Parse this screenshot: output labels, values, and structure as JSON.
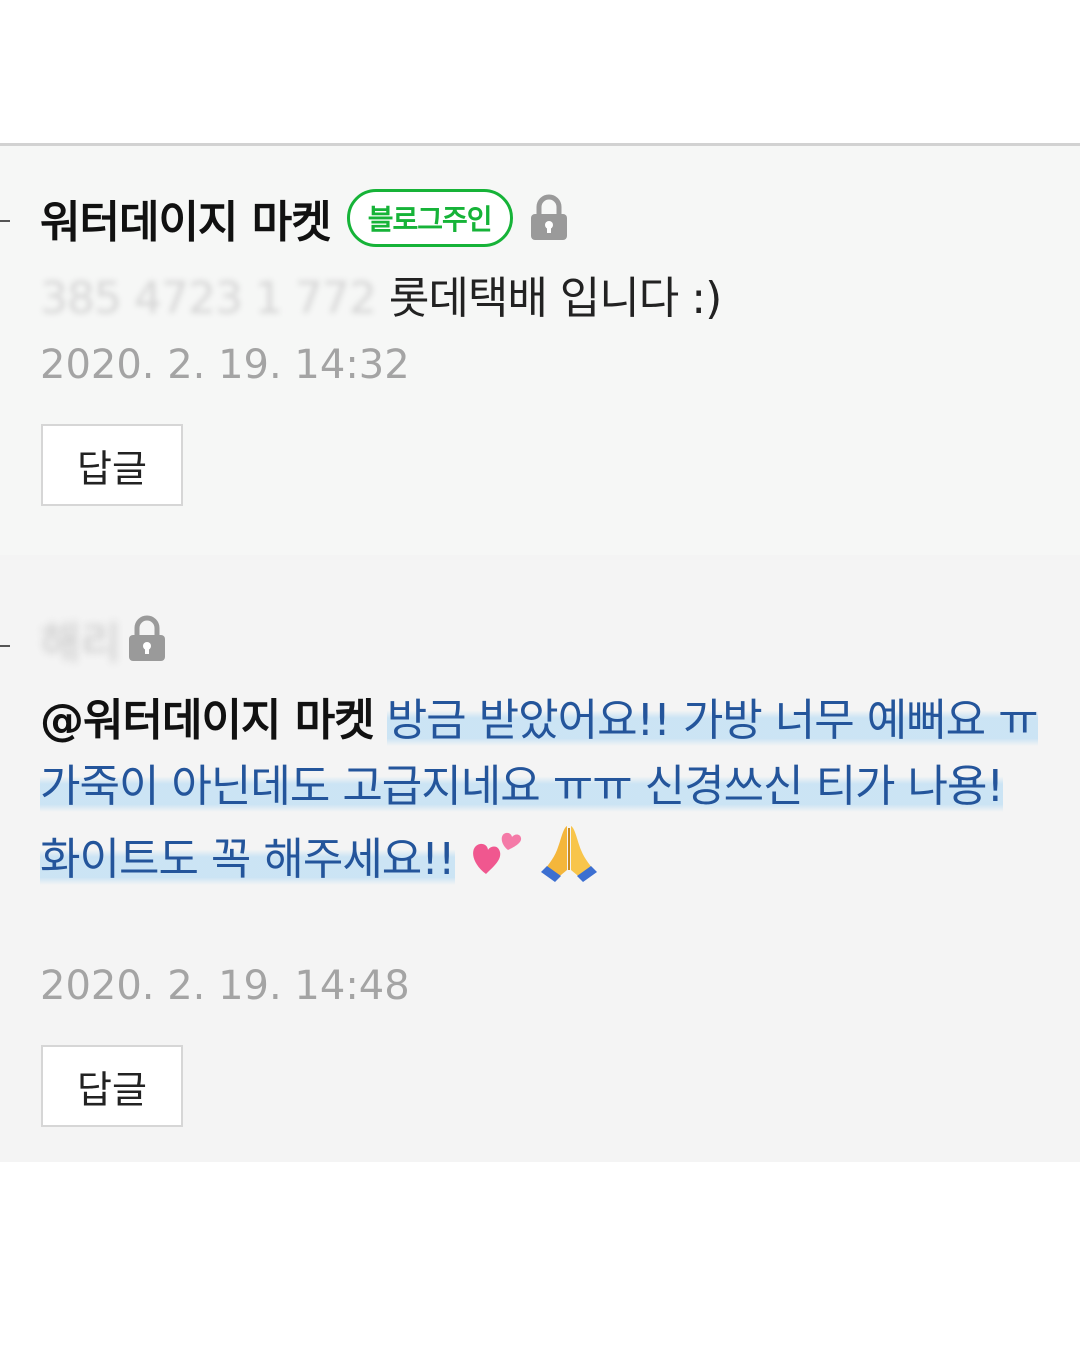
{
  "comments": [
    {
      "author": "워터데이지 마켓",
      "badge": "블로그주인",
      "text_blurred": "385 4723 1 772",
      "text": "롯데택배 입니다 :)",
      "timestamp": "2020. 2. 19. 14:32",
      "reply_label": "답글",
      "lock_icon": "lock-icon"
    },
    {
      "author": "해리",
      "mention": "@워터데이지 마켓",
      "lines": [
        "방금 받았어요!! 가방 너무 예뻐요 ㅠ",
        "가죽이 아닌데도 고급지네요 ㅠㅠ 신경쓰신 티가 나용!",
        "화이트도 꼭 해주세요!!"
      ],
      "emojis": [
        "two-hearts-icon",
        "folded-hands-icon"
      ],
      "timestamp": "2020. 2. 19. 14:48",
      "reply_label": "답글",
      "lock_icon": "lock-icon"
    }
  ],
  "colors": {
    "badge_green": "#16b338",
    "highlight_text": "#24559b",
    "timestamp_gray": "#a4a4a4"
  }
}
